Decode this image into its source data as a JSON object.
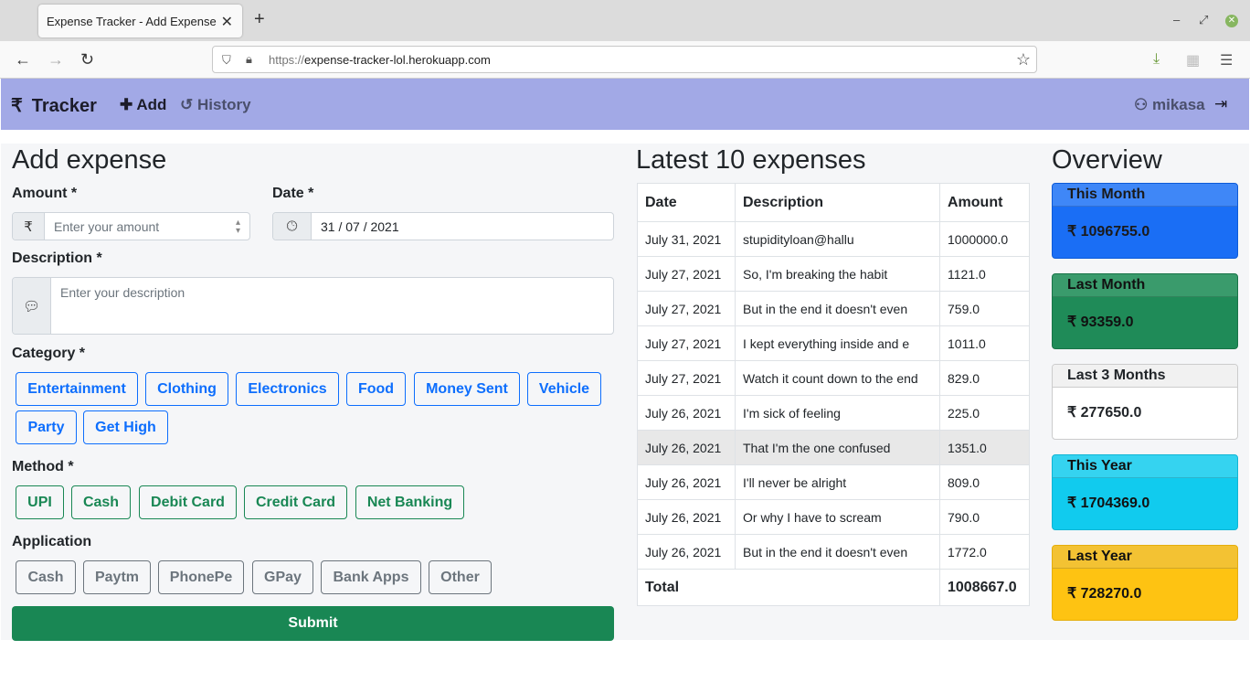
{
  "browser": {
    "tab_title": "Expense Tracker - Add Expense",
    "url_protocol": "https://",
    "url_host": "expense-tracker-lol.herokuapp.com"
  },
  "nav": {
    "brand_icon": "₹",
    "brand": "Tracker",
    "add": "Add",
    "history": "History",
    "user": "mikasa"
  },
  "form": {
    "title": "Add expense",
    "amount_label": "Amount *",
    "amount_icon": "₹",
    "amount_placeholder": "Enter your amount",
    "date_label": "Date *",
    "date_value": "31 / 07 / 2021",
    "description_label": "Description *",
    "description_placeholder": "Enter your description",
    "category_label": "Category *",
    "categories": [
      "Entertainment",
      "Clothing",
      "Electronics",
      "Food",
      "Money Sent",
      "Vehicle",
      "Party",
      "Get High"
    ],
    "method_label": "Method *",
    "methods": [
      "UPI",
      "Cash",
      "Debit Card",
      "Credit Card",
      "Net Banking"
    ],
    "application_label": "Application",
    "applications": [
      "Cash",
      "Paytm",
      "PhonePe",
      "GPay",
      "Bank Apps",
      "Other"
    ],
    "submit": "Submit"
  },
  "latest": {
    "title": "Latest 10 expenses",
    "headers": [
      "Date",
      "Description",
      "Amount"
    ],
    "rows": [
      [
        "July 31, 2021",
        "stupidityloan@hallu",
        "1000000.0"
      ],
      [
        "July 27, 2021",
        "So, I'm breaking the habit",
        "1121.0"
      ],
      [
        "July 27, 2021",
        "But in the end it doesn't even",
        "759.0"
      ],
      [
        "July 27, 2021",
        "I kept everything inside and e",
        "1011.0"
      ],
      [
        "July 27, 2021",
        "Watch it count down to the end",
        "829.0"
      ],
      [
        "July 26, 2021",
        "I'm sick of feeling",
        "225.0"
      ],
      [
        "July 26, 2021",
        "That I'm the one confused",
        "1351.0"
      ],
      [
        "July 26, 2021",
        "I'll never be alright",
        "809.0"
      ],
      [
        "July 26, 2021",
        "Or why I have to scream",
        "790.0"
      ],
      [
        "July 26, 2021",
        "But in the end it doesn't even",
        "1772.0"
      ]
    ],
    "total_label": "Total",
    "total_value": "1008667.0"
  },
  "overview": {
    "title": "Overview",
    "cards": [
      {
        "title": "This Month",
        "value": "₹ 1096755.0"
      },
      {
        "title": "Last Month",
        "value": "₹ 93359.0"
      },
      {
        "title": "Last 3 Months",
        "value": "₹ 277650.0"
      },
      {
        "title": "This Year",
        "value": "₹ 1704369.0"
      },
      {
        "title": "Last Year",
        "value": "₹ 728270.0"
      }
    ]
  }
}
